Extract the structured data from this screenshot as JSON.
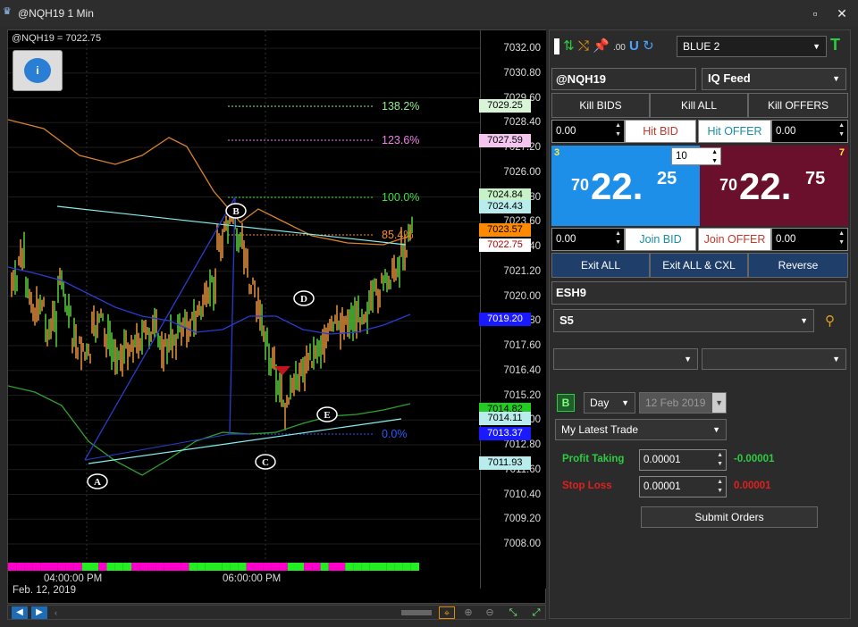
{
  "window": {
    "title": "@NQH19 1 Min",
    "restore_icon": "restore-icon",
    "close_icon": "close-icon"
  },
  "chart": {
    "header": "@NQH19 = 7022.75",
    "yticks": [
      "7032.00",
      "7030.80",
      "7029.60",
      "7028.40",
      "7027.20",
      "7026.00",
      "7024.80",
      "7023.60",
      "7022.40",
      "7021.20",
      "7020.00",
      "7018.80",
      "7017.60",
      "7016.40",
      "7015.20",
      "7014.00",
      "7012.80",
      "7011.60",
      "7010.40",
      "7009.20",
      "7008.00"
    ],
    "price_boxes": [
      {
        "label": "7029.25",
        "bg": "#d8f5d8",
        "fg": "#000"
      },
      {
        "label": "7027.59",
        "bg": "#f4c6ef",
        "fg": "#000"
      },
      {
        "label": "7024.84",
        "bg": "#c8f2c8",
        "fg": "#000"
      },
      {
        "label": "7024.43",
        "bg": "#b9ecec",
        "fg": "#000"
      },
      {
        "label": "7023.57",
        "bg": "#ff8a00",
        "fg": "#000"
      },
      {
        "label": "7022.75",
        "bg": "#ffffff",
        "fg": "#b00000"
      },
      {
        "label": "7019.20",
        "bg": "#1a1aff",
        "fg": "#fff"
      },
      {
        "label": "7014.82",
        "bg": "#22cc22",
        "fg": "#000"
      },
      {
        "label": "7014.11",
        "bg": "#b9ecec",
        "fg": "#000"
      },
      {
        "label": "7013.37",
        "bg": "#1a1aff",
        "fg": "#fff"
      },
      {
        "label": "7011.93",
        "bg": "#b9ecec",
        "fg": "#000"
      }
    ],
    "fib_levels": [
      {
        "label": "138.2%",
        "color": "#8ef08e"
      },
      {
        "label": "123.6%",
        "color": "#f080e8"
      },
      {
        "label": "100.0%",
        "color": "#40e040"
      },
      {
        "label": "85.4%",
        "color": "#ff9020"
      },
      {
        "label": "0.0%",
        "color": "#2a5cff"
      }
    ],
    "pattern_points": [
      "A",
      "B",
      "C",
      "D",
      "E"
    ],
    "x_labels": [
      "04:00:00 PM",
      "06:00:00 PM"
    ],
    "date_label": "Feb. 12, 2019"
  },
  "panel": {
    "scheme": "BLUE 2",
    "symbol": "@NQH19",
    "feed": "IQ Feed",
    "kill_bids": "Kill BIDS",
    "kill_all": "Kill ALL",
    "kill_offers": "Kill OFFERS",
    "hit_bid_price": "0.00",
    "hit_bid": "Hit BID",
    "hit_offer": "Hit OFFER",
    "hit_offer_price": "0.00",
    "bid_size": "3",
    "ask_size": "7",
    "qty": "10",
    "bid_big": "70",
    "bid_main": "22.",
    "bid_frac": "25",
    "ask_big": "70",
    "ask_main": "22.",
    "ask_frac": "75",
    "join_bid_price": "0.00",
    "join_bid": "Join BID",
    "join_offer": "Join OFFER",
    "join_offer_price": "0.00",
    "exit_all": "Exit ALL",
    "exit_all_cxl": "Exit ALL & CXL",
    "reverse": "Reverse",
    "account_symbol": "ESH9",
    "strategy": "S5",
    "tif": "Day",
    "date": "12 Feb 2019",
    "b_label": "B",
    "order_type": "My Latest Trade",
    "profit_label": "Profit Taking",
    "profit_value": "0.00001",
    "profit_result": "-0.00001",
    "stop_label": "Stop Loss",
    "stop_value": "0.00001",
    "stop_result": "0.00001",
    "submit": "Submit Orders"
  }
}
